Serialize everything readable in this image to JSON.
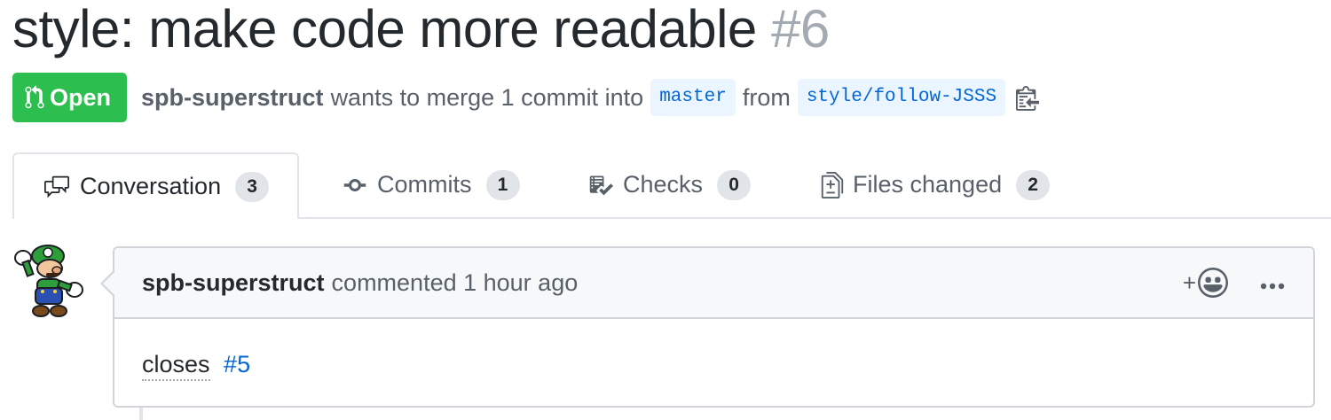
{
  "pr": {
    "title": "style: make code more readable",
    "number": "#6",
    "state": "Open",
    "author": "spb-superstruct",
    "merge_text": "wants to merge 1 commit into",
    "base_branch": "master",
    "from_text": "from",
    "head_branch": "style/follow-JSSS"
  },
  "tabs": [
    {
      "label": "Conversation",
      "count": "3",
      "icon": "comment-discussion-icon"
    },
    {
      "label": "Commits",
      "count": "1",
      "icon": "git-commit-icon"
    },
    {
      "label": "Checks",
      "count": "0",
      "icon": "checklist-icon"
    },
    {
      "label": "Files changed",
      "count": "2",
      "icon": "file-diff-icon"
    }
  ],
  "comment": {
    "author": "spb-superstruct",
    "action": "commented 1 hour ago",
    "reaction_plus": "+",
    "body_text": "closes",
    "body_link": "#5"
  },
  "colors": {
    "open_green": "#2cbe4e",
    "link_blue": "#0366d6",
    "branch_bg": "#eaf5ff",
    "muted": "#586069"
  }
}
